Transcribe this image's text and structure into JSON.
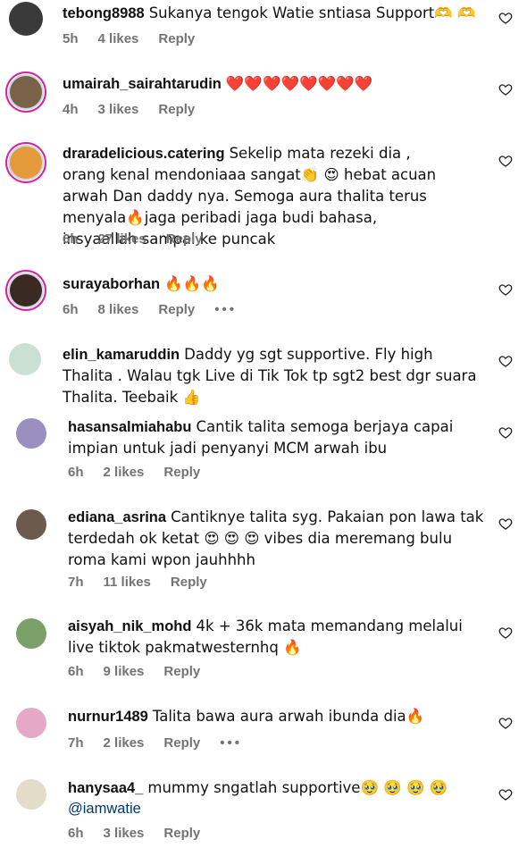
{
  "comments": [
    {
      "username": "tebong8988",
      "text": "Sukanya tengok Watie sntiasa Support🫶 🫶",
      "time": "5h",
      "likes": "4 likes",
      "reply": "Reply",
      "more": ""
    },
    {
      "username": "umairah_sairahtarudin",
      "text": "❤️❤️❤️❤️❤️❤️❤️❤️",
      "time": "4h",
      "likes": "3 likes",
      "reply": "Reply",
      "more": ""
    },
    {
      "username": "draradelicious.catering",
      "text": "Sekelip mata rezeki dia , orang kenal mendoniaaa sangat👏 😍 hebat acuan arwah Dan daddy nya. Semoga aura thalita terus menyala🔥jaga peribadi jaga budi bahasa, insyaallah sampai ke puncak",
      "time": "6h",
      "likes": "27 likes",
      "reply": "Reply",
      "more": ""
    },
    {
      "username": "surayaborhan",
      "text": "🔥🔥🔥",
      "time": "6h",
      "likes": "8 likes",
      "reply": "Reply",
      "more": "•••"
    },
    {
      "username": "elin_kamaruddin",
      "text": "Daddy yg sgt supportive. Fly high Thalita . Walau tgk Live di Tik Tok tp sgt2 best dgr suara Thalita. Teebaik 👍",
      "time": "",
      "likes": "",
      "reply": "",
      "more": ""
    },
    {
      "username": "hasansalmiahabu",
      "text": "Cantik talita semoga berjaya capai impian untuk jadi penyanyi MCM arwah ibu",
      "time": "6h",
      "likes": "2 likes",
      "reply": "Reply",
      "more": ""
    },
    {
      "username": "ediana_asrina",
      "text": "Cantiknye talita syg. Pakaian pon lawa tak terdedah ok ketat 😍 😍 😍 vibes dia meremang bulu roma kami wpon jauhhhh",
      "time": "7h",
      "likes": "11 likes",
      "reply": "Reply",
      "more": ""
    },
    {
      "username": "aisyah_nik_mohd",
      "text": "4k + 36k mata memandang melalui live tiktok pakmatwesternhq 🔥",
      "time": "6h",
      "likes": "9 likes",
      "reply": "Reply",
      "more": ""
    },
    {
      "username": "nurnur1489",
      "text": "Talita bawa aura arwah ibunda dia🔥",
      "time": "7h",
      "likes": "2 likes",
      "reply": "Reply",
      "more": "•••"
    },
    {
      "username": "hanysaa4_",
      "text": "mummy sngatlah supportive🥹 🥹 🥹 🥹",
      "mention": "@iamwatie",
      "time": "6h",
      "likes": "3 likes",
      "reply": "Reply",
      "more": ""
    }
  ],
  "colors": {
    "ring": "#d6249f",
    "meta": "#737373",
    "mention": "#00376b"
  },
  "icons": {
    "like": "heart-outline-icon",
    "more": "more-dots-icon"
  }
}
